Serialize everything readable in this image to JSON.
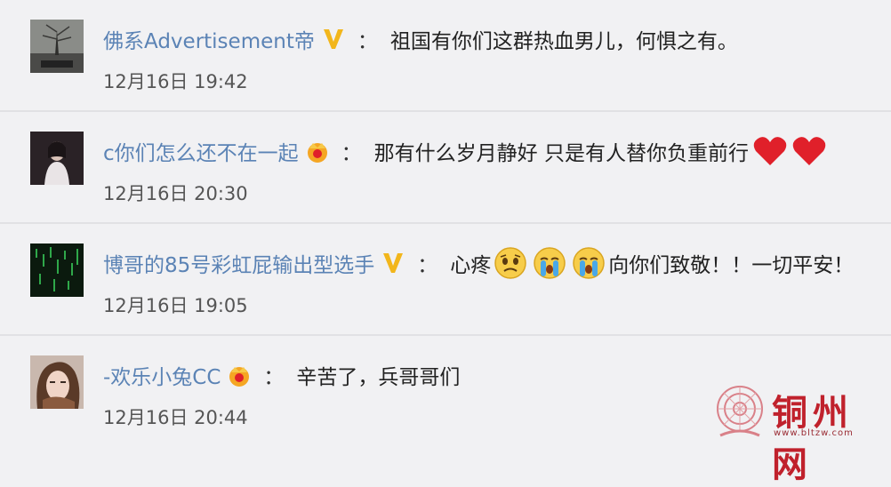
{
  "comments": [
    {
      "username": "佛系Advertisement帝",
      "badge": "v-icon",
      "colon": "：",
      "text": "祖国有你们这群热血男儿，何惧之有。",
      "time": "12月16日 19:42"
    },
    {
      "username": "c你们怎么还不在一起",
      "badge": "crown-icon",
      "colon": "：",
      "text": "那有什么岁月静好 只是有人替你负重前行",
      "time": "12月16日 20:30"
    },
    {
      "username": "博哥的85号彩虹屁输出型选手",
      "badge": "v-icon",
      "colon": "：",
      "text_a": "心疼",
      "text_b": "向你们致敬！！一切平安！",
      "time": "12月16日 19:05"
    },
    {
      "username": "-欢乐小兔CC",
      "badge": "crown-icon",
      "colon": "：",
      "text": "辛苦了，兵哥哥们",
      "time": "12月16日 20:44"
    }
  ],
  "watermark": {
    "name": "铜州网",
    "url": "www.bltzw.com"
  },
  "colors": {
    "username": "#5b83b5",
    "background": "#f1f1f3",
    "heart": "#e0202a",
    "v_badge": "#f2b61c",
    "watermark": "#c0212c"
  }
}
